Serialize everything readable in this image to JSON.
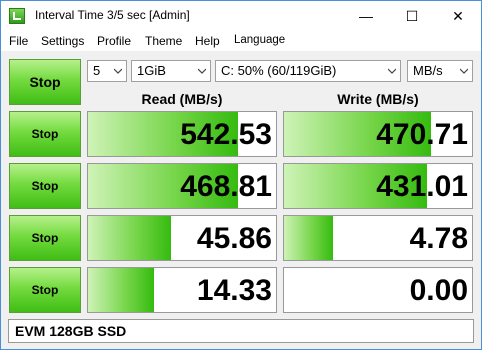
{
  "window": {
    "title": "Interval Time 3/5 sec [Admin]",
    "controls": {
      "minimize": "—",
      "maximize": "☐",
      "close": "✕"
    }
  },
  "menu": [
    "File",
    "Settings",
    "Profile",
    "Theme",
    "Help",
    "Language"
  ],
  "toolbar": {
    "main_button": "Stop",
    "count": "5",
    "size": "1GiB",
    "drive": "C: 50% (60/119GiB)",
    "unit": "MB/s"
  },
  "headers": {
    "read": "Read (MB/s)",
    "write": "Write (MB/s)"
  },
  "rows": [
    {
      "button": "Stop",
      "read": "542.53",
      "write": "470.71",
      "read_fill": 0.8,
      "write_fill": 0.78
    },
    {
      "button": "Stop",
      "read": "468.81",
      "write": "431.01",
      "read_fill": 0.8,
      "write_fill": 0.76
    },
    {
      "button": "Stop",
      "read": "45.86",
      "write": "4.78",
      "read_fill": 0.44,
      "write_fill": 0.26
    },
    {
      "button": "Stop",
      "read": "14.33",
      "write": "0.00",
      "read_fill": 0.35,
      "write_fill": 0.0
    }
  ],
  "comment": "EVM 128GB SSD",
  "colors": {
    "accent_green": "#3fbd15",
    "window_border": "#4a90d9"
  }
}
